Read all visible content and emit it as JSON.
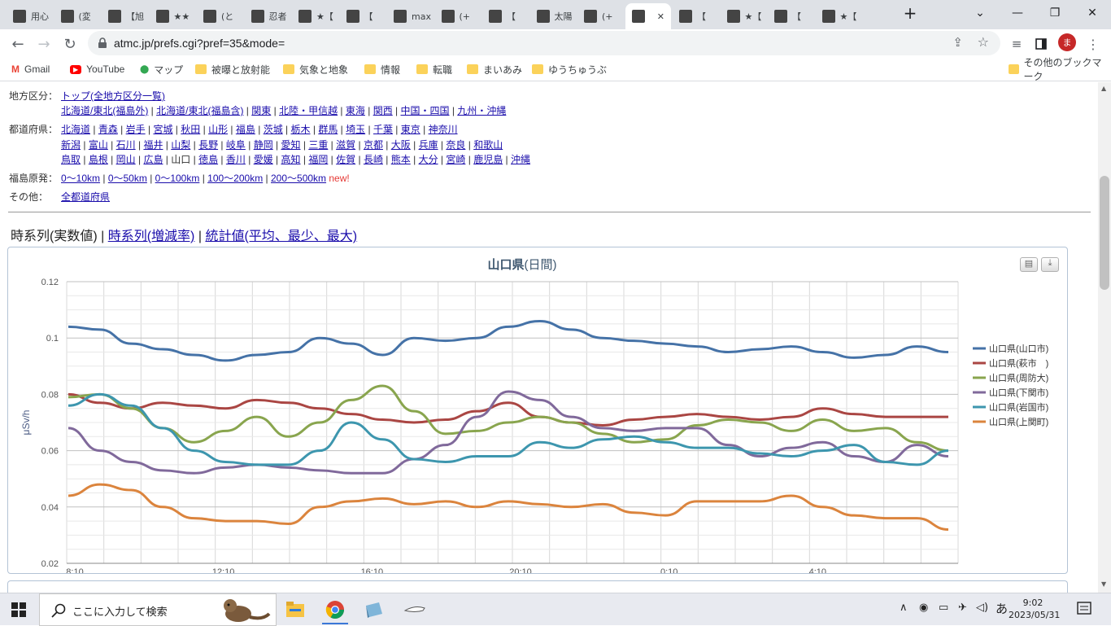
{
  "browser": {
    "tabs": [
      {
        "title": "用心"
      },
      {
        "title": "(変"
      },
      {
        "title": "【旭"
      },
      {
        "title": "★★"
      },
      {
        "title": "(と"
      },
      {
        "title": "忍者"
      },
      {
        "title": "★【"
      },
      {
        "title": "【"
      },
      {
        "title": "max"
      },
      {
        "title": "(+"
      },
      {
        "title": "【"
      },
      {
        "title": "太陽"
      },
      {
        "title": "(+"
      },
      {
        "title": ""
      },
      {
        "title": "【"
      },
      {
        "title": "★【"
      },
      {
        "title": "【"
      },
      {
        "title": "★【"
      }
    ],
    "active_tab_index": 13,
    "url": "atmc.jp/prefs.cgi?pref=35&mode=",
    "profile_initial": "ま",
    "bookmarks": [
      "Gmail",
      "YouTube",
      "マップ",
      "被曝と放射能",
      "気象と地象",
      "情報",
      "転職",
      "まいあみ",
      "ゆうちゅうぶ"
    ],
    "other_bookmarks": "その他のブックマーク"
  },
  "page": {
    "region_label": "地方区分：",
    "region_links_row1": [
      "トップ(全地方区分一覧)"
    ],
    "region_links_row2": [
      "北海道/東北(福島外)",
      "北海道/東北(福島含)",
      "関東",
      "北陸・甲信越",
      "東海",
      "関西",
      "中国・四国",
      "九州・沖縄"
    ],
    "pref_label": "都道府県：",
    "pref_row1": [
      "北海道",
      "青森",
      "岩手",
      "宮城",
      "秋田",
      "山形",
      "福島",
      "茨城",
      "栃木",
      "群馬",
      "埼玉",
      "千葉",
      "東京",
      "神奈川"
    ],
    "pref_row2": [
      "新潟",
      "富山",
      "石川",
      "福井",
      "山梨",
      "長野",
      "岐阜",
      "静岡",
      "愛知",
      "三重",
      "滋賀",
      "京都",
      "大阪",
      "兵庫",
      "奈良",
      "和歌山"
    ],
    "pref_row3": [
      "鳥取",
      "島根",
      "岡山",
      "広島",
      "山口",
      "徳島",
      "香川",
      "愛媛",
      "高知",
      "福岡",
      "佐賀",
      "長崎",
      "熊本",
      "大分",
      "宮崎",
      "鹿児島",
      "沖縄"
    ],
    "current_pref": "山口",
    "fukushima_label": "福島原発：",
    "fukushima_links": [
      "0～10km",
      "0～50km",
      "0～100km",
      "100～200km",
      "200～500km"
    ],
    "new_label": "new!",
    "other_label": "その他：",
    "other_links": [
      "全都道府県"
    ],
    "mode_current": "時系列(実数値)",
    "mode_links": [
      "時系列(増減率)",
      "統計値(平均、最少、最大)"
    ]
  },
  "chart_data": {
    "type": "line",
    "title": "山口県",
    "subtitle": "(日間)",
    "ylabel": "μSv/h",
    "ylim": [
      0.02,
      0.12
    ],
    "yticks": [
      "0.02",
      "0.04",
      "0.06",
      "0.08",
      "0.1",
      "0.12"
    ],
    "xtick_labels": [
      "8:10",
      "12:10",
      "16:10",
      "20:10",
      "0:10",
      "4:10"
    ],
    "x_points": 24,
    "series": [
      {
        "name": "山口県(山口市)",
        "color": "#4572a7",
        "values": [
          0.104,
          0.103,
          0.098,
          0.096,
          0.094,
          0.092,
          0.094,
          0.095,
          0.1,
          0.098,
          0.094,
          0.1,
          0.099,
          0.1,
          0.104,
          0.106,
          0.103,
          0.1,
          0.099,
          0.098,
          0.097,
          0.095,
          0.096,
          0.097,
          0.095,
          0.093,
          0.094,
          0.097,
          0.095
        ]
      },
      {
        "name": "山口県(萩市　)",
        "color": "#aa4643",
        "values": [
          0.08,
          0.077,
          0.075,
          0.077,
          0.076,
          0.075,
          0.078,
          0.077,
          0.075,
          0.073,
          0.071,
          0.07,
          0.071,
          0.074,
          0.077,
          0.072,
          0.07,
          0.069,
          0.071,
          0.072,
          0.073,
          0.072,
          0.071,
          0.072,
          0.075,
          0.073,
          0.072,
          0.072,
          0.072
        ]
      },
      {
        "name": "山口県(周防大)",
        "color": "#89a54e",
        "values": [
          0.079,
          0.08,
          0.075,
          0.068,
          0.063,
          0.067,
          0.072,
          0.065,
          0.07,
          0.078,
          0.083,
          0.074,
          0.066,
          0.067,
          0.07,
          0.072,
          0.07,
          0.066,
          0.063,
          0.064,
          0.069,
          0.071,
          0.07,
          0.067,
          0.071,
          0.067,
          0.068,
          0.063,
          0.06
        ]
      },
      {
        "name": "山口県(下関市)",
        "color": "#80699b",
        "values": [
          0.068,
          0.06,
          0.056,
          0.053,
          0.052,
          0.054,
          0.055,
          0.054,
          0.053,
          0.052,
          0.052,
          0.057,
          0.062,
          0.072,
          0.081,
          0.078,
          0.072,
          0.068,
          0.067,
          0.068,
          0.068,
          0.062,
          0.058,
          0.061,
          0.063,
          0.058,
          0.056,
          0.062,
          0.058
        ]
      },
      {
        "name": "山口県(岩国市)",
        "color": "#3d96ae",
        "values": [
          0.076,
          0.08,
          0.076,
          0.068,
          0.06,
          0.056,
          0.055,
          0.055,
          0.06,
          0.07,
          0.064,
          0.057,
          0.056,
          0.058,
          0.058,
          0.063,
          0.061,
          0.064,
          0.065,
          0.063,
          0.061,
          0.061,
          0.059,
          0.058,
          0.06,
          0.062,
          0.056,
          0.055,
          0.06
        ]
      },
      {
        "name": "山口県(上関町)",
        "color": "#db843d",
        "values": [
          0.044,
          0.048,
          0.046,
          0.04,
          0.036,
          0.035,
          0.035,
          0.034,
          0.04,
          0.042,
          0.043,
          0.041,
          0.042,
          0.04,
          0.042,
          0.041,
          0.04,
          0.041,
          0.038,
          0.037,
          0.042,
          0.042,
          0.042,
          0.044,
          0.04,
          0.037,
          0.036,
          0.036,
          0.032
        ]
      }
    ],
    "legend_position": "right",
    "grid": true
  },
  "taskbar": {
    "search_placeholder": "ここに入力して検索",
    "ime": "あ",
    "time": "9:02",
    "date": "2023/05/31"
  }
}
